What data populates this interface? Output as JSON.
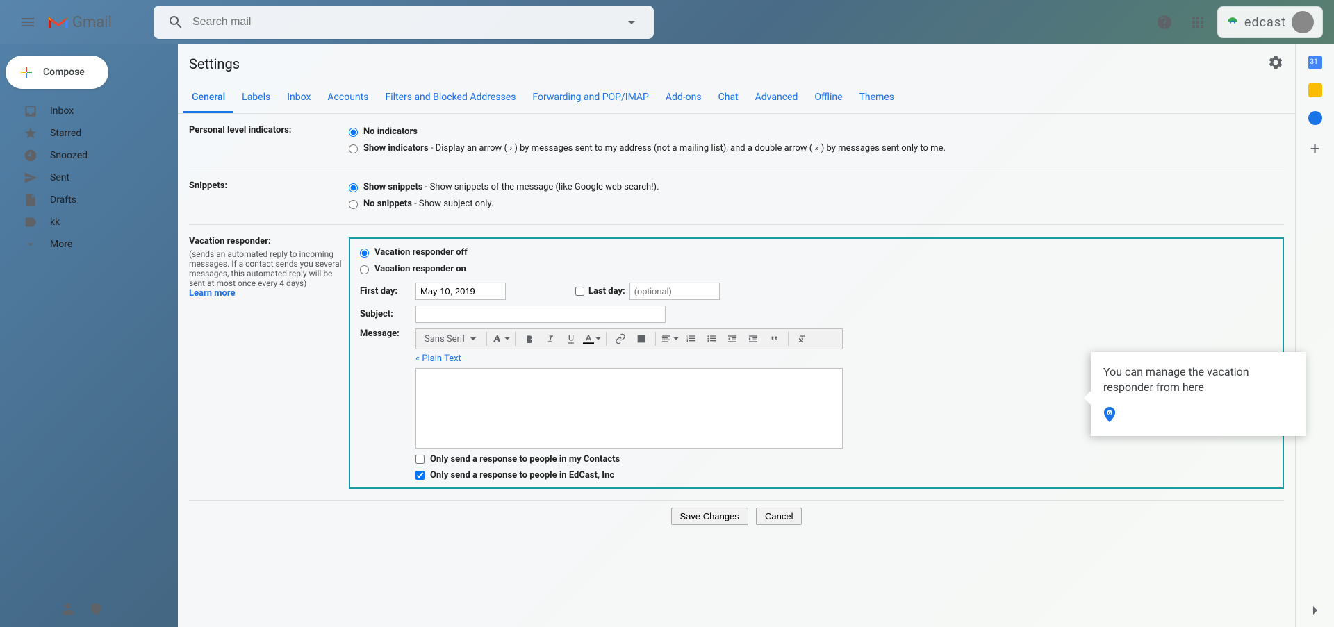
{
  "header": {
    "logo_text": "Gmail",
    "search_placeholder": "Search mail",
    "brand_text": "edcast"
  },
  "sidebar": {
    "compose": "Compose",
    "items": [
      {
        "label": "Inbox"
      },
      {
        "label": "Starred"
      },
      {
        "label": "Snoozed"
      },
      {
        "label": "Sent"
      },
      {
        "label": "Drafts"
      },
      {
        "label": "kk"
      },
      {
        "label": "More"
      }
    ]
  },
  "settings": {
    "title": "Settings",
    "tabs": [
      "General",
      "Labels",
      "Inbox",
      "Accounts",
      "Filters and Blocked Addresses",
      "Forwarding and POP/IMAP",
      "Add-ons",
      "Chat",
      "Advanced",
      "Offline",
      "Themes"
    ],
    "active_tab": 0,
    "personal_level": {
      "label": "Personal level indicators:",
      "no_indicators": "No indicators",
      "show_indicators": "Show indicators",
      "show_indicators_desc": " - Display an arrow ( › ) by messages sent to my address (not a mailing list), and a double arrow ( » ) by messages sent only to me."
    },
    "snippets": {
      "label": "Snippets:",
      "show_title": "Show snippets",
      "show_desc": " - Show snippets of the message (like Google web search!).",
      "no_title": "No snippets",
      "no_desc": " - Show subject only."
    },
    "vacation": {
      "label": "Vacation responder:",
      "sub": "(sends an automated reply to incoming messages. If a contact sends you several messages, this automated reply will be sent at most once every 4 days)",
      "learn_more": "Learn more",
      "off_label": "Vacation responder off",
      "on_label": "Vacation responder on",
      "first_day_label": "First day:",
      "first_day_value": "May 10, 2019",
      "last_day_label": "Last day:",
      "last_day_placeholder": "(optional)",
      "subject_label": "Subject:",
      "subject_value": "",
      "message_label": "Message:",
      "font_family": "Sans Serif",
      "plain_text": "« Plain Text",
      "contacts_only": "Only send a response to people in my Contacts",
      "org_only": "Only send a response to people in EdCast, Inc"
    },
    "save_row": {
      "save": "Save Changes",
      "cancel": "Cancel"
    }
  },
  "tooltip": {
    "text": "You can manage the vacation responder from here"
  }
}
